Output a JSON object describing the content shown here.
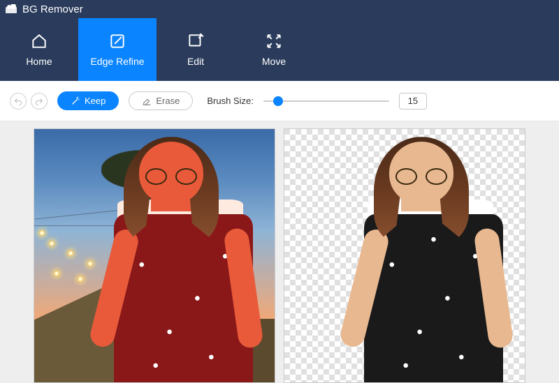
{
  "app": {
    "title": "BG Remover"
  },
  "nav": {
    "items": [
      {
        "label": "Home"
      },
      {
        "label": "Edge Refine"
      },
      {
        "label": "Edit"
      },
      {
        "label": "Move"
      }
    ],
    "active_index": 1
  },
  "toolbar": {
    "undo_icon": "undo-icon",
    "redo_icon": "redo-icon",
    "keep_label": "Keep",
    "erase_label": "Erase",
    "brush_label": "Brush Size:",
    "brush_size_value": "15",
    "slider_percent": 8
  },
  "colors": {
    "accent": "#0a84ff",
    "navbar": "#2a3b5c"
  }
}
